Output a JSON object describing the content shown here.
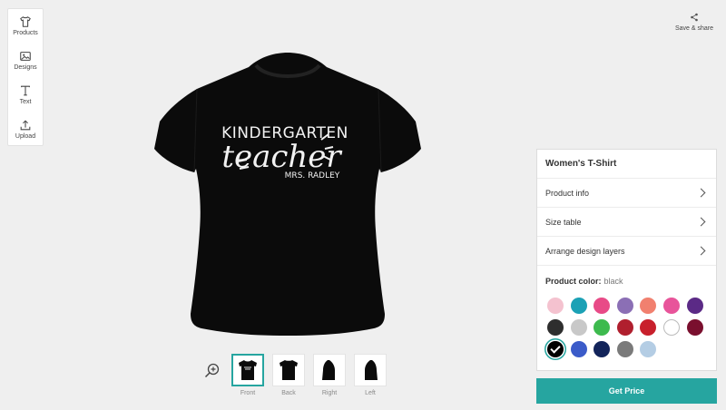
{
  "toolbar": {
    "products": "Products",
    "designs": "Designs",
    "text": "Text",
    "upload": "Upload"
  },
  "share": {
    "label": "Save & share"
  },
  "design": {
    "line1": "KINDERGARTEN",
    "line2": "teacher",
    "line3": "MRS. RADLEY"
  },
  "views": [
    {
      "label": "Front"
    },
    {
      "label": "Back"
    },
    {
      "label": "Right"
    },
    {
      "label": "Left"
    }
  ],
  "panel": {
    "title": "Women's T-Shirt",
    "rows": [
      "Product info",
      "Size table",
      "Arrange design layers"
    ],
    "color_label": "Product color:",
    "color_value": "black"
  },
  "swatches": [
    "#f4c2cf",
    "#1ba1b5",
    "#e84a87",
    "#8b6fb5",
    "#f1806f",
    "#e8549a",
    "#5b2a86",
    "#2e2e2e",
    "#c8c8c8",
    "#3dba4e",
    "#b01f2e",
    "#c8202c",
    "#ffffff",
    "#7a0f2e",
    "#000000",
    "#3b5bc9",
    "#12245a",
    "#7a7a7a",
    "#b4cde4"
  ],
  "selected_color": "#000000",
  "cta": {
    "label": "Get Price"
  },
  "colors": {
    "accent": "#26a5a0"
  }
}
